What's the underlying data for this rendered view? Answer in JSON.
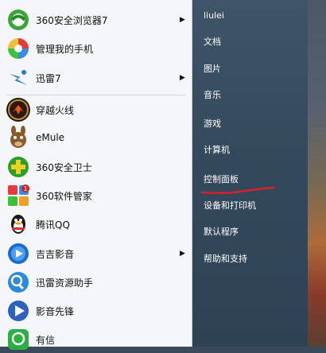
{
  "programs": [
    {
      "label": "360安全浏览器7",
      "arrow": true,
      "icon": "360-browser-icon"
    },
    {
      "label": "管理我的手机",
      "arrow": false,
      "icon": "phone-manager-icon"
    },
    {
      "label": "迅雷7",
      "arrow": true,
      "icon": "thunder-icon"
    },
    {
      "label": "穿越火线",
      "arrow": false,
      "icon": "crossfire-icon"
    },
    {
      "label": "eMule",
      "arrow": false,
      "icon": "emule-icon"
    },
    {
      "label": "360安全卫士",
      "arrow": false,
      "icon": "360-safe-icon"
    },
    {
      "label": "360软件管家",
      "arrow": false,
      "icon": "360-software-manager-icon"
    },
    {
      "label": "腾讯QQ",
      "arrow": false,
      "icon": "qq-icon"
    },
    {
      "label": "吉吉影音",
      "arrow": true,
      "icon": "jiji-player-icon"
    },
    {
      "label": "迅雷资源助手",
      "arrow": false,
      "icon": "thunder-assistant-icon"
    },
    {
      "label": "影音先锋",
      "arrow": false,
      "icon": "xfplay-icon"
    },
    {
      "label": "有信",
      "arrow": false,
      "icon": "youxin-icon"
    }
  ],
  "right": {
    "user": "liulei",
    "documents": "文档",
    "pictures": "图片",
    "music": "音乐",
    "games": "游戏",
    "computer": "计算机",
    "control_panel": "控制面板",
    "devices": "设备和打印机",
    "default_programs": "默认程序",
    "help": "帮助和支持"
  },
  "arrow_glyph": "▶",
  "colors": {
    "left_bg": "#f4f6f9",
    "right_bg": "#3a4f63",
    "highlight_mark": "#d4212a"
  }
}
